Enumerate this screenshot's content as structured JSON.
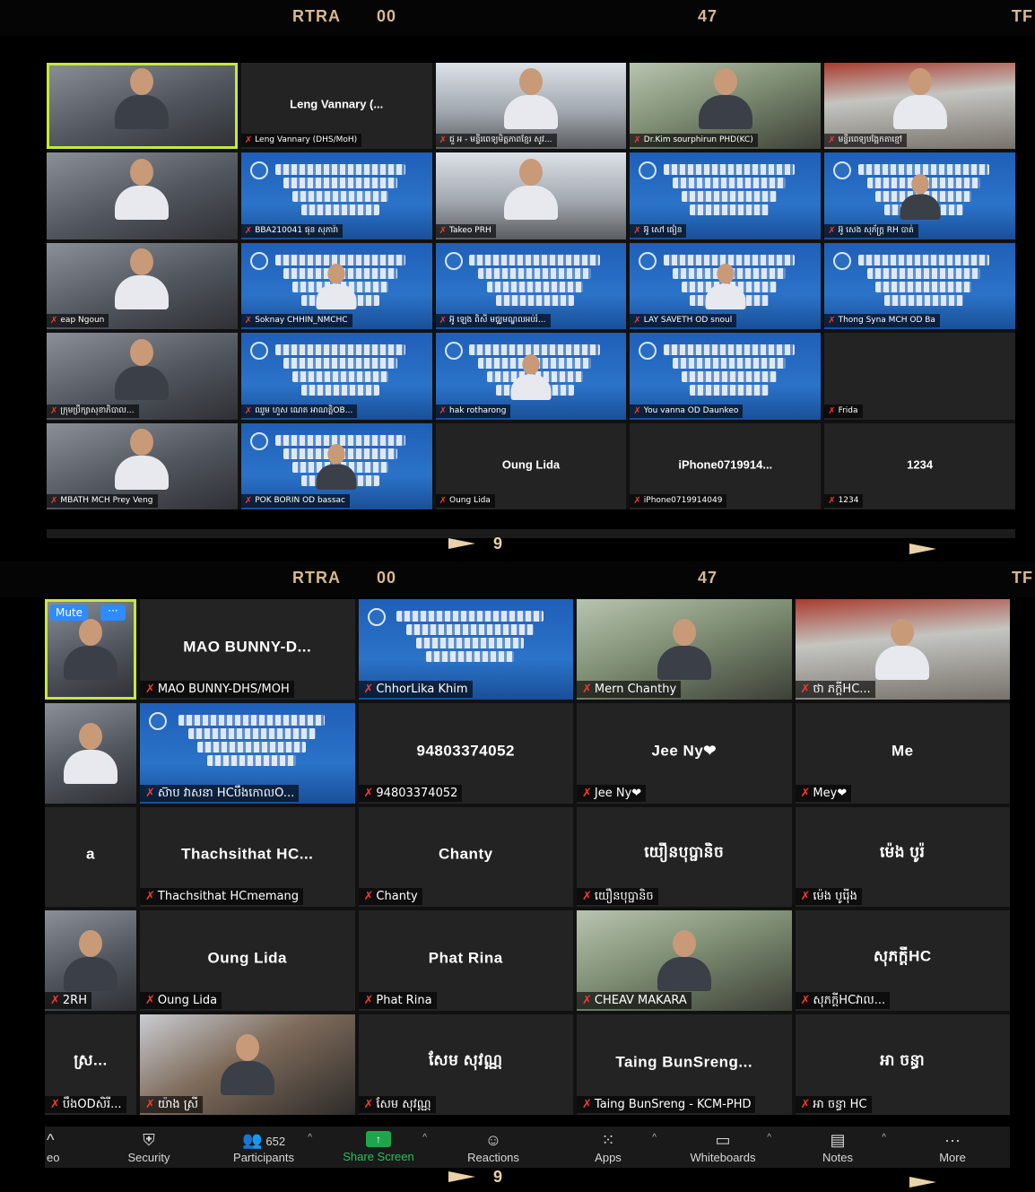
{
  "header": {
    "left": "RTRA",
    "zeros": "00",
    "mid": "47",
    "right": "TF"
  },
  "page_indicator": "9",
  "screen1": {
    "tiles": [
      {
        "type": "cam",
        "label": "",
        "active": true
      },
      {
        "type": "name",
        "center": "Leng Vannary (...",
        "label": "Leng Vannary (DHS/MoH)"
      },
      {
        "type": "cam",
        "label": "ជួ អ - មន្ទីរពេទ្យមិត្តភាពខ្មែរ សូវ..."
      },
      {
        "type": "cam",
        "label": "Dr.Kim sourphirun PHD(KC)"
      },
      {
        "type": "cam",
        "label": "មន្ទីរពេទ្យបង្អែកតាខ្មៅ"
      },
      {
        "type": "cam",
        "label": ""
      },
      {
        "type": "banner",
        "label": "BBA210041 ផុន សុភារ៉ា"
      },
      {
        "type": "cam",
        "label": "Takeo PRH"
      },
      {
        "type": "banner",
        "label": "អ៊ូ សៅ ផៀន"
      },
      {
        "type": "banner",
        "label": "អ៊ូ សេង សុភ័ក្ត្រ RH បាត់"
      },
      {
        "type": "cam",
        "label": "eap Ngoun"
      },
      {
        "type": "banner",
        "label": "Soknay CHHIN_NMCHC"
      },
      {
        "type": "banner",
        "label": "អ៊ូ ឡេង ពិសី មជ្ឈមណ្ឌលអប់រំ..."
      },
      {
        "type": "banner",
        "label": "LAY SAVETH OD snoul"
      },
      {
        "type": "banner",
        "label": "Thong Syna MCH OD Ba"
      },
      {
        "type": "cam",
        "label": "ក្រុមប្រឹក្សាសុខាភិបាល..."
      },
      {
        "type": "banner",
        "label": "ឈួម ហួស ណេត អាណត្តិOB..."
      },
      {
        "type": "banner",
        "label": "hak rotharong"
      },
      {
        "type": "banner",
        "label": "You vanna OD Daunkeo"
      },
      {
        "type": "blank",
        "label": "Frida"
      },
      {
        "type": "cam",
        "label": "MBATH MCH Prey Veng"
      },
      {
        "type": "banner",
        "label": "POK BORIN OD bassac"
      },
      {
        "type": "name",
        "center": "Oung Lida",
        "label": "Oung Lida"
      },
      {
        "type": "name",
        "center": "iPhone0719914...",
        "label": "iPhone0719914049"
      },
      {
        "type": "name",
        "center": "1234",
        "label": "1234"
      }
    ]
  },
  "screen2": {
    "mute_button": "Mute",
    "more_button": "···",
    "tiles": [
      {
        "type": "cam",
        "label": "",
        "active": true
      },
      {
        "type": "name",
        "center": "MAO BUNNY-D...",
        "label": "MAO BUNNY-DHS/MOH"
      },
      {
        "type": "banner",
        "label": "ChhorLika Khim"
      },
      {
        "type": "cam",
        "label": "Mern Chanthy"
      },
      {
        "type": "cam",
        "label": "ថា ភក្តីHC..."
      },
      {
        "type": "cam",
        "label": ""
      },
      {
        "type": "banner",
        "label": "ស៊ាប វាសនា HCបឹងកោលO..."
      },
      {
        "type": "name",
        "center": "94803374052",
        "label": "94803374052"
      },
      {
        "type": "name",
        "center": "Jee Ny❤",
        "label": "Jee Ny❤"
      },
      {
        "type": "name",
        "center": "Me",
        "label": "Mey❤"
      },
      {
        "type": "name",
        "center": "a",
        "label": ""
      },
      {
        "type": "name",
        "center": "Thachsithat  HC...",
        "label": "Thachsithat HCmemang"
      },
      {
        "type": "name",
        "center": "Chanty",
        "label": "Chanty"
      },
      {
        "type": "name",
        "center": "យឿនបុប្ផានិច",
        "label": "យឿនបុប្ផានិច"
      },
      {
        "type": "name",
        "center": "ម៉េង បូរ៉",
        "label": "ម៉េង បូរ៉ើង"
      },
      {
        "type": "cam",
        "label": "2RH"
      },
      {
        "type": "name",
        "center": "Oung Lida",
        "label": "Oung Lida"
      },
      {
        "type": "name",
        "center": "Phat Rina",
        "label": "Phat Rina"
      },
      {
        "type": "cam",
        "label": "CHEAV MAKARA"
      },
      {
        "type": "name",
        "center": "សុភក្តីHC",
        "label": "សុភក្តីHCវាល..."
      },
      {
        "type": "name",
        "center": "ស្រ...",
        "label": "បឹងODសិរី..."
      },
      {
        "type": "cam",
        "label": "យ៉ាង ស្រី"
      },
      {
        "type": "name",
        "center": "សែម សុវណ្ណ",
        "label": "សែម សុវណ្ណ"
      },
      {
        "type": "name",
        "center": "Taing  BunSreng...",
        "label": "Taing BunSreng - KCM-PHD"
      },
      {
        "type": "name",
        "center": "អា ចន្ធា",
        "label": "អា ចន្ធា HC"
      }
    ]
  },
  "toolbar": {
    "items": [
      {
        "id": "video",
        "label": "eo",
        "icon": "video-icon",
        "glyph": "^",
        "narrow": true
      },
      {
        "id": "security",
        "label": "Security",
        "icon": "shield-icon",
        "glyph": "⛨"
      },
      {
        "id": "participants",
        "label": "Participants",
        "icon": "participants-icon",
        "glyph": "👥",
        "count": "652",
        "caret": true
      },
      {
        "id": "share",
        "label": "Share Screen",
        "icon": "share-screen-icon",
        "glyph": "↑",
        "caret": true,
        "accent": "#1ea64b"
      },
      {
        "id": "reactions",
        "label": "Reactions",
        "icon": "reactions-icon",
        "glyph": "☺"
      },
      {
        "id": "apps",
        "label": "Apps",
        "icon": "apps-icon",
        "glyph": "⁙",
        "caret": true
      },
      {
        "id": "whiteboards",
        "label": "Whiteboards",
        "icon": "whiteboard-icon",
        "glyph": "▭",
        "caret": true
      },
      {
        "id": "notes",
        "label": "Notes",
        "icon": "notes-icon",
        "glyph": "▤",
        "caret": true
      },
      {
        "id": "more",
        "label": "More",
        "icon": "more-icon",
        "glyph": "···"
      }
    ]
  },
  "colors": {
    "active_border": "#c7e83e",
    "mic_muted": "#ee3d2f",
    "banner_blue": "#2b73c9",
    "zoom_blue": "#2d8cff"
  }
}
